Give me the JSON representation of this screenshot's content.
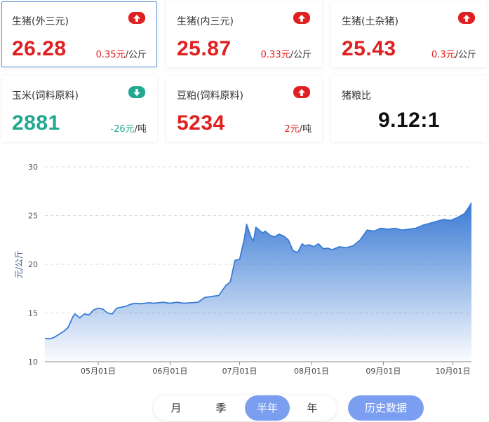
{
  "cards": [
    {
      "name": "生猪(外三元)",
      "value": "26.28",
      "change": "0.35元",
      "unit": "/公斤",
      "trend": "up",
      "selected": true
    },
    {
      "name": "生猪(内三元)",
      "value": "25.87",
      "change": "0.33元",
      "unit": "/公斤",
      "trend": "up"
    },
    {
      "name": "生猪(土杂猪)",
      "value": "25.43",
      "change": "0.3元",
      "unit": "/公斤",
      "trend": "up"
    },
    {
      "name": "玉米(饲料原料)",
      "value": "2881",
      "change": "-26元",
      "unit": "/吨",
      "trend": "down"
    },
    {
      "name": "豆粕(饲料原料)",
      "value": "5234",
      "change": "2元",
      "unit": "/吨",
      "trend": "up"
    },
    {
      "name": "猪粮比",
      "value": "9.12:1"
    }
  ],
  "colors": {
    "up": "#e02020",
    "down": "#20a890",
    "accent": "#7b9ef0",
    "series": "#3a7bd5"
  },
  "chart_data": {
    "type": "area",
    "ylabel": "元/公斤",
    "ylim": [
      10,
      30
    ],
    "yticks": [
      10,
      15,
      20,
      25,
      30
    ],
    "grid": true,
    "x_tick_labels": [
      "05月01日",
      "06月01日",
      "07月01日",
      "08月01日",
      "09月01日",
      "10月01日"
    ],
    "x_tick_dates": [
      "2022-05-01",
      "2022-06-01",
      "2022-07-01",
      "2022-08-01",
      "2022-09-01",
      "2022-10-01"
    ],
    "x_range": [
      "2022-04-08",
      "2022-10-09"
    ],
    "series": [
      {
        "x": [
          "2022-04-08",
          "2022-04-10",
          "2022-04-12",
          "2022-04-14",
          "2022-04-16",
          "2022-04-18",
          "2022-04-20",
          "2022-04-21",
          "2022-04-23",
          "2022-04-25",
          "2022-04-27",
          "2022-04-29",
          "2022-05-01",
          "2022-05-03",
          "2022-05-05",
          "2022-05-07",
          "2022-05-09",
          "2022-05-11",
          "2022-05-13",
          "2022-05-15",
          "2022-05-17",
          "2022-05-19",
          "2022-05-21",
          "2022-05-23",
          "2022-05-25",
          "2022-05-27",
          "2022-05-29",
          "2022-06-01",
          "2022-06-04",
          "2022-06-07",
          "2022-06-10",
          "2022-06-13",
          "2022-06-16",
          "2022-06-19",
          "2022-06-22",
          "2022-06-25",
          "2022-06-27",
          "2022-06-29",
          "2022-07-01",
          "2022-07-03",
          "2022-07-04",
          "2022-07-06",
          "2022-07-07",
          "2022-07-08",
          "2022-07-09",
          "2022-07-11",
          "2022-07-12",
          "2022-07-14",
          "2022-07-16",
          "2022-07-18",
          "2022-07-20",
          "2022-07-22",
          "2022-07-24",
          "2022-07-26",
          "2022-07-28",
          "2022-07-29",
          "2022-07-31",
          "2022-08-02",
          "2022-08-04",
          "2022-08-06",
          "2022-08-08",
          "2022-08-10",
          "2022-08-13",
          "2022-08-16",
          "2022-08-19",
          "2022-08-22",
          "2022-08-25",
          "2022-08-28",
          "2022-08-31",
          "2022-09-03",
          "2022-09-06",
          "2022-09-09",
          "2022-09-12",
          "2022-09-15",
          "2022-09-18",
          "2022-09-21",
          "2022-09-24",
          "2022-09-27",
          "2022-09-30",
          "2022-10-03",
          "2022-10-06",
          "2022-10-08",
          "2022-10-09"
        ],
        "y": [
          12.4,
          12.35,
          12.5,
          12.8,
          13.1,
          13.5,
          14.6,
          14.9,
          14.5,
          14.9,
          14.8,
          15.3,
          15.5,
          15.4,
          15.0,
          14.9,
          15.5,
          15.6,
          15.7,
          15.9,
          16.0,
          15.95,
          16.0,
          16.05,
          16.0,
          16.05,
          16.1,
          16.0,
          16.1,
          16.0,
          16.05,
          16.1,
          16.6,
          16.7,
          16.8,
          17.8,
          18.2,
          20.4,
          20.5,
          22.6,
          24.1,
          22.7,
          22.4,
          23.8,
          23.6,
          23.2,
          23.4,
          23.0,
          22.8,
          23.1,
          22.9,
          22.5,
          21.4,
          21.2,
          22.1,
          21.9,
          22.0,
          21.8,
          22.1,
          21.6,
          21.65,
          21.5,
          21.8,
          21.7,
          21.9,
          22.5,
          23.5,
          23.4,
          23.7,
          23.6,
          23.7,
          23.5,
          23.6,
          23.7,
          24.0,
          24.2,
          24.4,
          24.6,
          24.5,
          24.8,
          25.2,
          25.9,
          26.3
        ]
      }
    ]
  },
  "periods": [
    "月",
    "季",
    "半年",
    "年"
  ],
  "active_period": 2,
  "history_label": "历史数据"
}
